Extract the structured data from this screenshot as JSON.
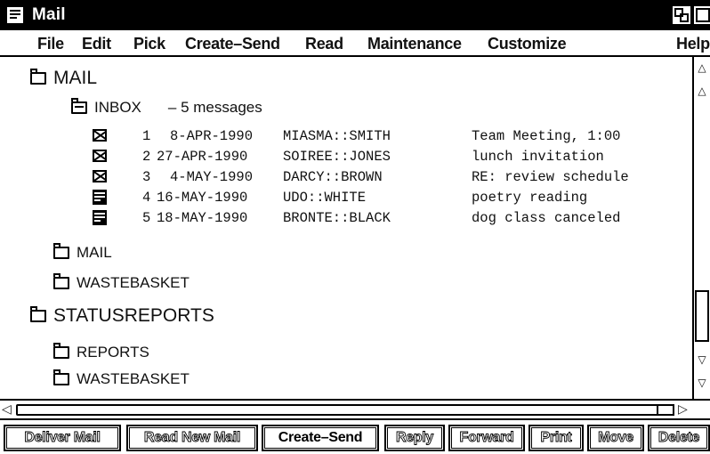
{
  "window": {
    "title": "Mail"
  },
  "menu": [
    "File",
    "Edit",
    "Pick",
    "Create–Send",
    "Read",
    "Maintenance",
    "Customize",
    "Help"
  ],
  "tree": {
    "root1": "MAIL",
    "inbox_name": "INBOX",
    "inbox_count": "– 5 messages",
    "sub_mail": "MAIL",
    "sub_waste1": "WASTEBASKET",
    "root2": "STATUSREPORTS",
    "sub_reports": "REPORTS",
    "sub_waste2": "WASTEBASKET"
  },
  "messages": [
    {
      "num": "1",
      "date": "8-APR-1990",
      "from": "MIASMA::SMITH",
      "subject": "Team Meeting, 1:00",
      "icon": "envelope-icon"
    },
    {
      "num": "2",
      "date": "27-APR-1990",
      "from": "SOIREE::JONES",
      "subject": "lunch invitation",
      "icon": "envelope-icon"
    },
    {
      "num": "3",
      "date": "4-MAY-1990",
      "from": "DARCY::BROWN",
      "subject": "RE: review schedule",
      "icon": "envelope-icon"
    },
    {
      "num": "4",
      "date": "16-MAY-1990",
      "from": "UDO::WHITE",
      "subject": "poetry reading",
      "icon": "document-icon"
    },
    {
      "num": "5",
      "date": "18-MAY-1990",
      "from": "BRONTE::BLACK",
      "subject": "dog class canceled",
      "icon": "document-icon"
    }
  ],
  "buttons": [
    "Deliver Mail",
    "Read New Mail",
    "Create–Send",
    "Reply",
    "Forward",
    "Print",
    "Move",
    "Delete"
  ]
}
